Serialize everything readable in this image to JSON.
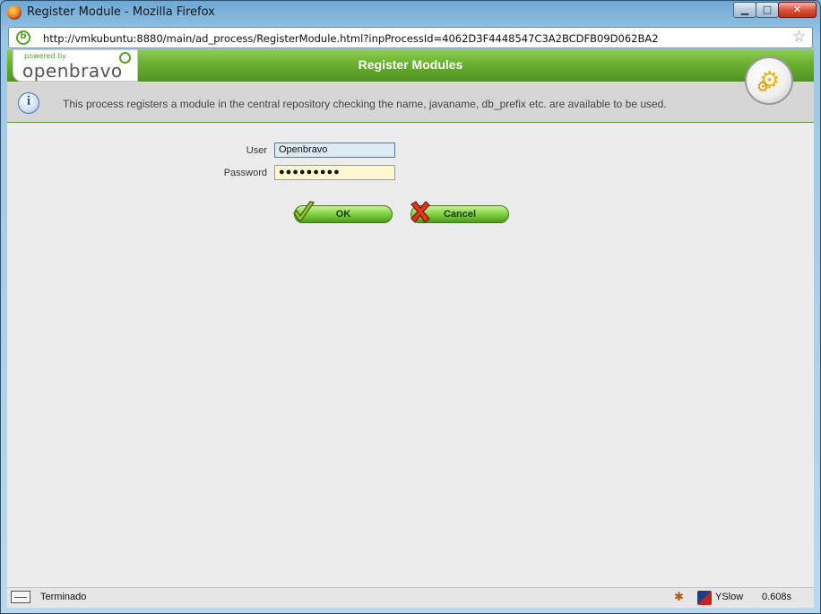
{
  "window": {
    "title": "Register Module - Mozilla Firefox",
    "minimize_glyph": "▁",
    "maximize_glyph": "□",
    "close_glyph": "✕"
  },
  "navbar": {
    "url": "http://vmkubuntu:8880/main/ad_process/RegisterModule.html?inpProcessId=4062D3F4448547C3A2BCDFB09D062BA2",
    "site_icon_glyph": "b",
    "bookmark_glyph": "☆"
  },
  "brand": {
    "powered_by": "powered by",
    "name": "openbravo"
  },
  "header": {
    "title": "Register Modules"
  },
  "info": {
    "icon_glyph": "i",
    "message": "This process registers a module in the central repository checking the name, javaname, db_prefix etc. are available to be used."
  },
  "form": {
    "user_label": "User",
    "user_value": "Openbravo",
    "password_label": "Password",
    "password_value": "●●●●●●●●●"
  },
  "buttons": {
    "ok_label": "OK",
    "cancel_label": "Cancel"
  },
  "status": {
    "text": "Terminado",
    "yslow": "YSlow",
    "timing": "0.608s"
  },
  "colors": {
    "header_green": "#6ab02e",
    "button_green": "#7fd140",
    "info_bar": "#d6d6d6"
  },
  "icons": [
    "firefox-icon",
    "site-icon",
    "bookmark-star-icon",
    "gear-icon",
    "info-icon",
    "checkmark-icon",
    "x-cancel-icon",
    "status-icon",
    "bug-icon",
    "yslow-icon"
  ]
}
